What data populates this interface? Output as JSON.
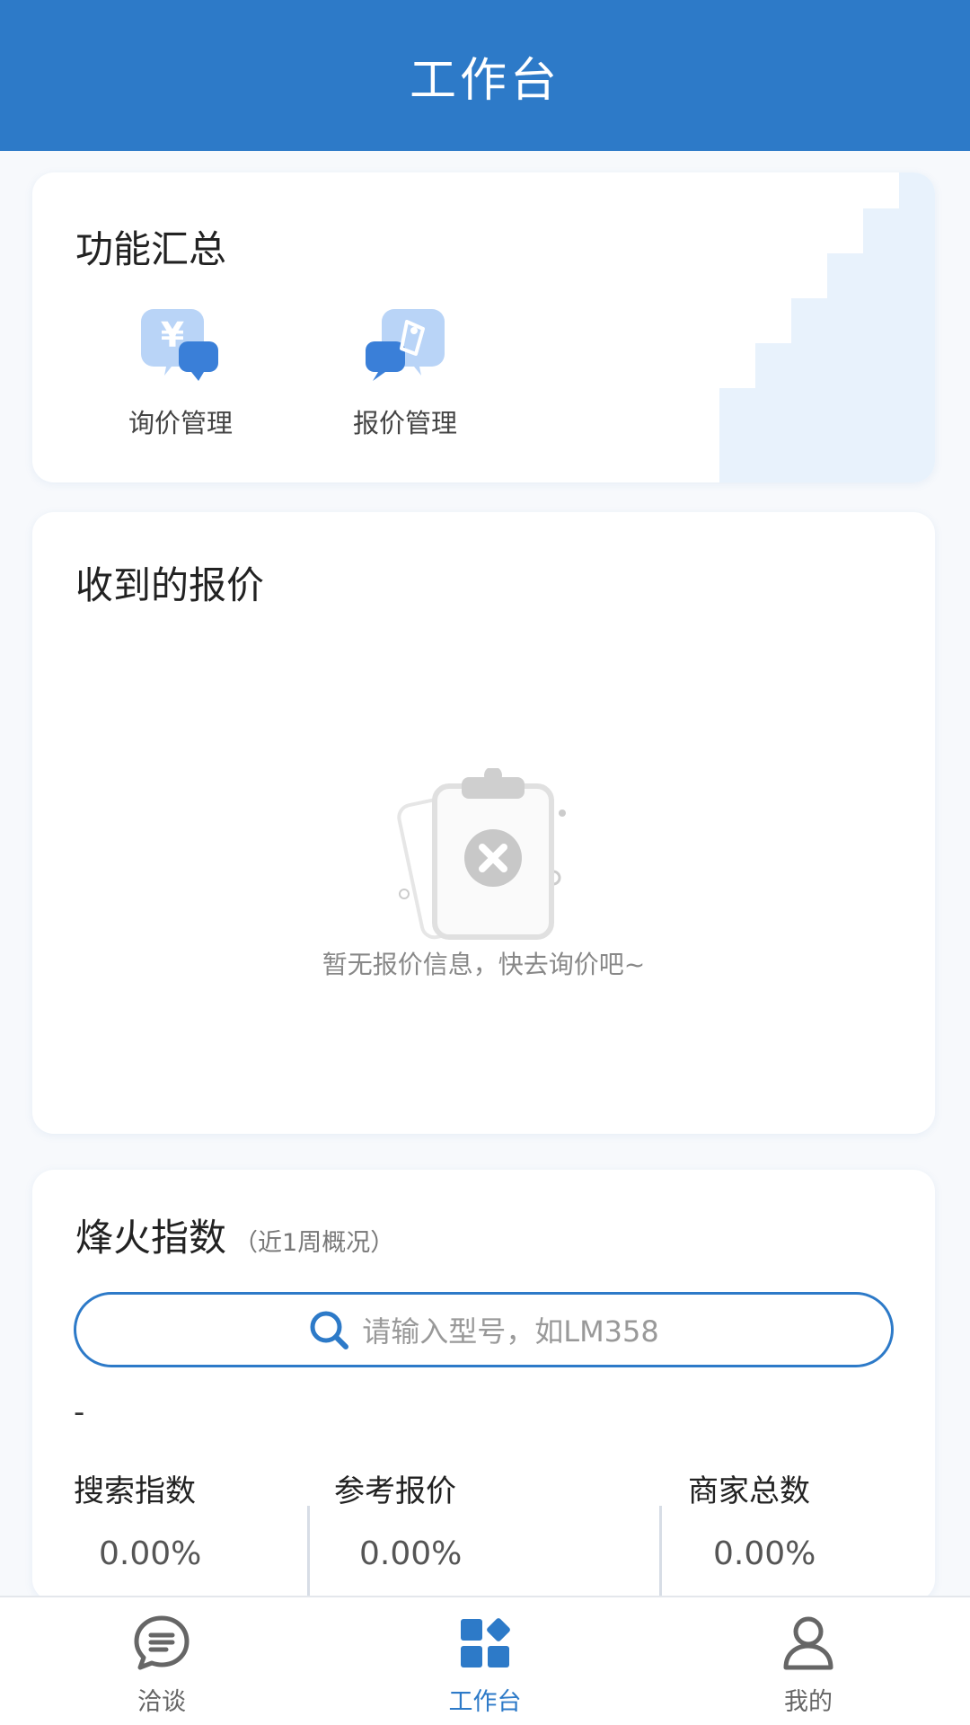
{
  "header": {
    "title": "工作台"
  },
  "functions": {
    "title": "功能汇总",
    "items": [
      {
        "label": "询价管理",
        "icon": "yuan-chat-icon"
      },
      {
        "label": "报价管理",
        "icon": "tag-chat-icon"
      }
    ]
  },
  "quotes": {
    "title": "收到的报价",
    "empty_text": "暂无报价信息，快去询价吧~",
    "empty_icon": "empty-clipboard-icon"
  },
  "index": {
    "title": "烽火指数",
    "subtitle": "（近1周概况）",
    "search_placeholder": "请输入型号，如LM358",
    "model_value": "-",
    "stats": [
      {
        "label": "搜索指数",
        "value": "0.00%"
      },
      {
        "label": "参考报价",
        "value": "0.00%"
      },
      {
        "label": "商家总数",
        "value": "0.00%"
      }
    ]
  },
  "nav": {
    "items": [
      {
        "label": "洽谈",
        "icon": "chat-bubble-icon",
        "active": false
      },
      {
        "label": "工作台",
        "icon": "grid-icon",
        "active": true
      },
      {
        "label": "我的",
        "icon": "user-icon",
        "active": false
      }
    ]
  },
  "colors": {
    "primary": "#2d7ac8",
    "nav_inactive": "#666666"
  }
}
